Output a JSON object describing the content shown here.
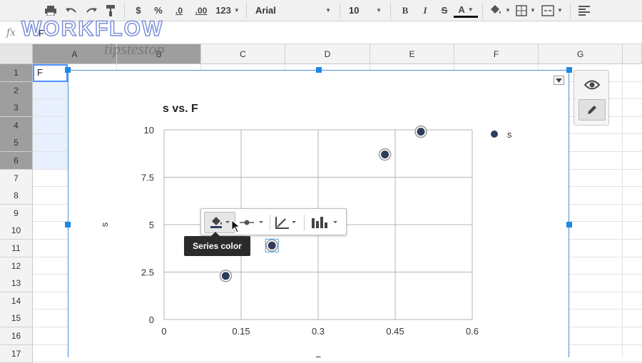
{
  "toolbar": {
    "print_icon": "print-icon",
    "undo_icon": "undo-icon",
    "redo_icon": "redo-icon",
    "paint_format_icon": "paint-format-icon",
    "currency": "$",
    "percent": "%",
    "decrease_decimals": ".0",
    "increase_decimals": ".00",
    "more_formats": "123",
    "font_family": "Arial",
    "font_size": "10",
    "bold": "B",
    "italic": "I",
    "strikethrough": "S",
    "text_color": "A"
  },
  "formula_bar": {
    "fx": "fx",
    "value": "F"
  },
  "watermark": {
    "title": "WORKFLOW",
    "subtitle": "tipstestop"
  },
  "columns": [
    "A",
    "B",
    "C",
    "D",
    "E",
    "F",
    "G"
  ],
  "rows": [
    "1",
    "2",
    "3",
    "4",
    "5",
    "6",
    "7",
    "8",
    "9",
    "10",
    "11",
    "12",
    "13",
    "14",
    "15",
    "16",
    "17"
  ],
  "cells": {
    "A1": "F"
  },
  "chart_data": {
    "type": "scatter",
    "title": "s vs. F",
    "xlabel": "F",
    "ylabel": "s",
    "xlim": [
      0,
      0.6
    ],
    "ylim": [
      0,
      10
    ],
    "x_ticks": [
      "0",
      "0.15",
      "0.3",
      "0.45",
      "0.6"
    ],
    "y_ticks": [
      "0",
      "2.5",
      "5",
      "7.5",
      "10"
    ],
    "grid": true,
    "legend_position": "top-right",
    "series": [
      {
        "name": "s",
        "color": "#2d3d5c",
        "points": [
          {
            "x": 0.12,
            "y": 2.3
          },
          {
            "x": 0.21,
            "y": 3.9
          },
          {
            "x": 0.43,
            "y": 8.7
          },
          {
            "x": 0.5,
            "y": 9.9
          }
        ]
      }
    ]
  },
  "series_toolbar": {
    "tooltip": "Series color",
    "items": [
      "series-color-icon",
      "point-style-icon",
      "trendline-icon",
      "chart-type-icon"
    ]
  },
  "side_panel": {
    "items": [
      "eye-icon",
      "pencil-icon"
    ]
  }
}
